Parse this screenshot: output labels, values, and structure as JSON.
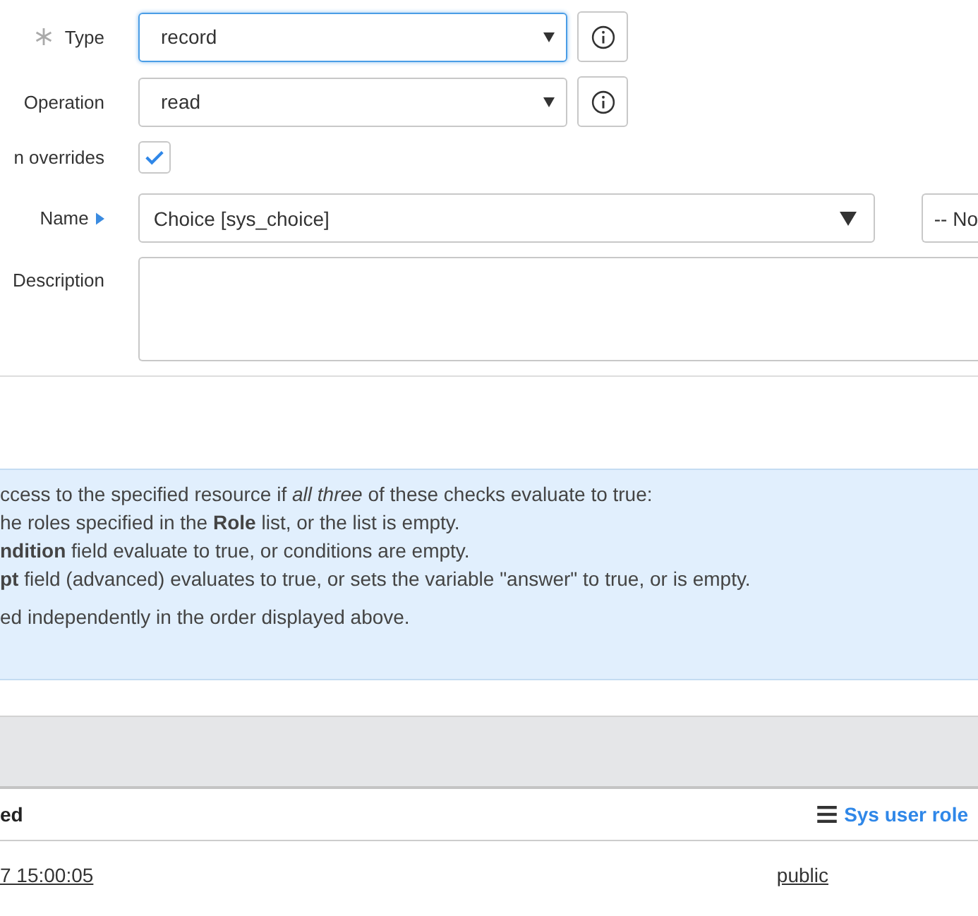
{
  "form": {
    "fields": [
      {
        "kind": "select",
        "label": "Type",
        "required": true,
        "focused": true,
        "value": "record",
        "info": true
      },
      {
        "kind": "select",
        "label": "Operation",
        "required": false,
        "focused": false,
        "value": "read",
        "info": true
      },
      {
        "kind": "checkbox",
        "label": "n overrides",
        "checked": true
      },
      {
        "kind": "reference",
        "label": "Name",
        "expander": true,
        "value": "Choice [sys_choice]",
        "secondary_value": "-- No"
      },
      {
        "kind": "textarea",
        "label": "Description"
      }
    ]
  },
  "info_box": {
    "lines": [
      "ccess to the specified resource if *all three* of these checks evaluate to true:",
      "he roles specified in the **Role** list, or the list is empty.",
      "**ndition** field evaluate to true, or conditions are empty.",
      "**pt** field (advanced) evaluates to true, or sets the variable \"answer\" to true, or is empty."
    ],
    "note": "ed independently in the order displayed above."
  },
  "table": {
    "columns": [
      {
        "label": "ed",
        "menu": false
      },
      {
        "label": "Sys user role",
        "menu": true
      }
    ],
    "rows": [
      [
        "7 15:00:05",
        "public"
      ]
    ]
  }
}
